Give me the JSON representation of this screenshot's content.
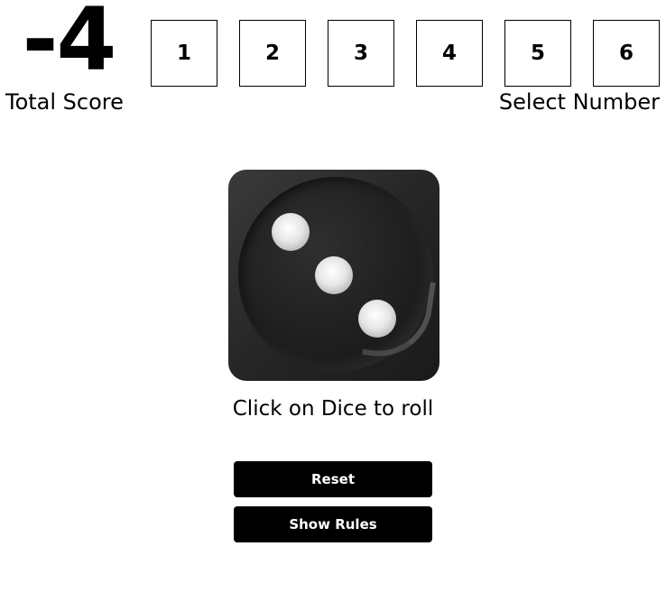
{
  "score": {
    "value": "-4",
    "label": "Total Score"
  },
  "number_select": {
    "label": "Select Number",
    "options": [
      "1",
      "2",
      "3",
      "4",
      "5",
      "6"
    ]
  },
  "dice": {
    "face_value": 3,
    "hint": "Click on Dice to roll"
  },
  "buttons": {
    "reset_label": "Reset",
    "rules_label": "Show Rules"
  },
  "colors": {
    "background": "#ffffff",
    "text": "#000000",
    "button_bg": "#000000",
    "button_text": "#ffffff",
    "dice_body": "#262626",
    "pip": "#e6e6e6"
  }
}
